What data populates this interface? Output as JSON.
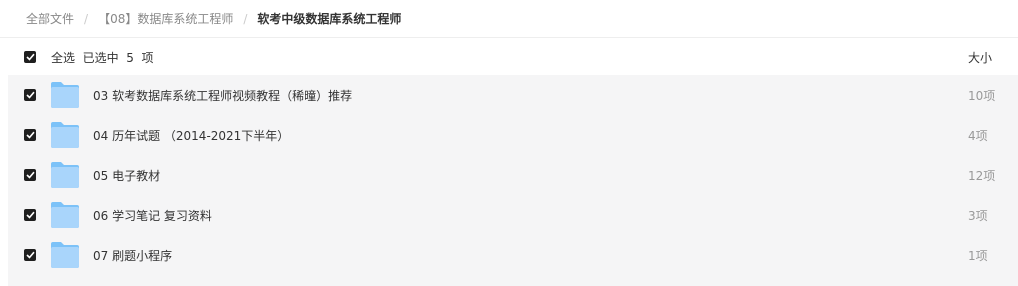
{
  "breadcrumb": {
    "items": [
      "全部文件",
      "【08】数据库系统工程师"
    ],
    "current": "软考中级数据库系统工程师"
  },
  "header": {
    "select_all_label": "全选",
    "selected_count": "已选中  5  项",
    "size_column": "大小"
  },
  "files": [
    {
      "name": "03 软考数据库系统工程师视频教程（稀曈）推荐",
      "size": "10项",
      "checked": true,
      "icon": "folder-icon"
    },
    {
      "name": "04 历年试题 （2014-2021下半年）",
      "size": "4项",
      "checked": true,
      "icon": "folder-icon"
    },
    {
      "name": "05 电子教材",
      "size": "12项",
      "checked": true,
      "icon": "folder-icon"
    },
    {
      "name": "06 学习笔记 复习资料",
      "size": "3项",
      "checked": true,
      "icon": "folder-icon"
    },
    {
      "name": "07 刷题小程序",
      "size": "1项",
      "checked": true,
      "icon": "folder-icon"
    }
  ],
  "colors": {
    "folder_light": "#a9d5fb",
    "folder_dark": "#7cc2f8",
    "checkbox": "#1f1f1f",
    "list_bg": "#f5f5f6"
  }
}
